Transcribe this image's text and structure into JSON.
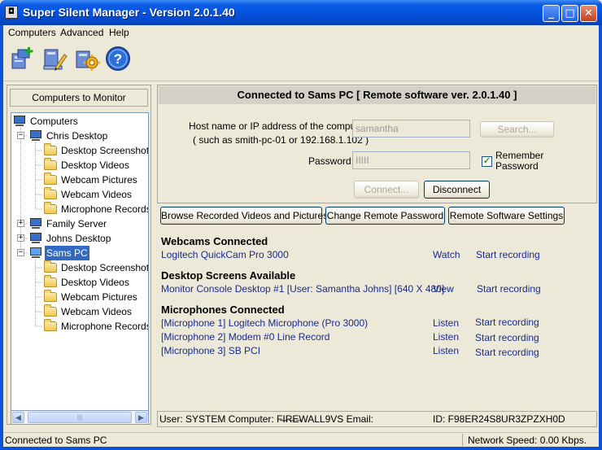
{
  "window": {
    "title": "Super Silent Manager - Version 2.0.1.40"
  },
  "menu": {
    "computers": "Computers",
    "advanced": "Advanced",
    "help": "Help"
  },
  "toolbar": {
    "icons": [
      "add-computer-icon",
      "edit-computer-icon",
      "settings-icon",
      "help-icon"
    ],
    "help_glyph": "?"
  },
  "left_panel": {
    "header": "Computers to Monitor",
    "root": "Computers",
    "computers": [
      {
        "name": "Chris Desktop",
        "expanded": true,
        "selected": false,
        "children": [
          "Desktop Screenshots",
          "Desktop Videos",
          "Webcam Pictures",
          "Webcam Videos",
          "Microphone Records"
        ]
      },
      {
        "name": "Family Server",
        "expanded": false,
        "selected": false,
        "children": []
      },
      {
        "name": "Johns Desktop",
        "expanded": false,
        "selected": false,
        "children": []
      },
      {
        "name": "Sams PC",
        "expanded": true,
        "selected": true,
        "children": [
          "Desktop Screenshots",
          "Desktop Videos",
          "Webcam Pictures",
          "Webcam Videos",
          "Microphone Records"
        ]
      }
    ]
  },
  "connection": {
    "heading": "Connected to Sams PC [ Remote software ver. 2.0.1.40 ]",
    "host_label_1": "Host name or IP address of the computer:",
    "host_label_2": "( such as smith-pc-01 or 192.168.1.102 )",
    "host_value": "samantha",
    "search_button": "Search...",
    "password_label": "Password:",
    "password_value": "IIIII",
    "remember_label_1": "Remember",
    "remember_label_2": "Password",
    "remember_checked": "✓",
    "connect_button": "Connect...",
    "disconnect_button": "Disconnect"
  },
  "actions": {
    "browse": "Browse Recorded Videos and Pictures",
    "change_password": "Change Remote Password",
    "remote_settings": "Remote Software Settings"
  },
  "webcams": {
    "title": "Webcams Connected",
    "items": [
      {
        "name": "Logitech QuickCam Pro 3000",
        "action": "Watch",
        "record": "Start recording"
      }
    ]
  },
  "desktops": {
    "title": "Desktop Screens Available",
    "items": [
      {
        "name": "Monitor Console Desktop #1 [User: Samantha Johns] [640 X 480]",
        "action": "View",
        "record": "Start recording"
      }
    ]
  },
  "microphones": {
    "title": "Microphones Connected",
    "items": [
      {
        "name": "[Microphone 1] Logitech Microphone (Pro 3000)",
        "action": "Listen",
        "record": "Start recording"
      },
      {
        "name": "[Microphone 2] Modem #0 Line Record",
        "action": "Listen",
        "record": "Start recording"
      },
      {
        "name": "[Microphone 3] SB PCI",
        "action": "Listen",
        "record": "Start recording"
      }
    ]
  },
  "info": {
    "user_line": "User: SYSTEM Computer: F̶I̶R̶E̶WALL9VS Email:",
    "id": "ID: F98ER24S8UR3ZPZXH0D"
  },
  "status": {
    "left": "Connected to Sams PC",
    "right": "Network Speed: 0.00 Kbps."
  },
  "colors": {
    "titlebar": "#0554e0",
    "selection": "#316ac5",
    "link": "#1a2a8c"
  }
}
